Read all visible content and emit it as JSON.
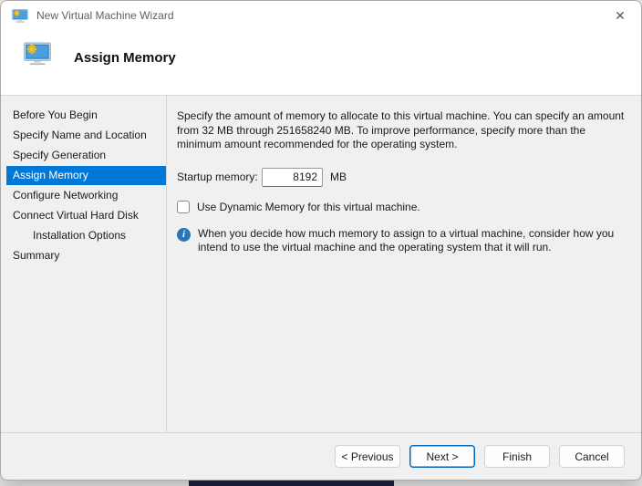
{
  "window": {
    "title": "New Virtual Machine Wizard",
    "icon": "vm-monitor-gear-icon",
    "close_glyph": "✕"
  },
  "header": {
    "title": "Assign Memory",
    "icon": "vm-monitor-gear-icon"
  },
  "sidebar": {
    "items": [
      {
        "label": "Before You Begin",
        "selected": false,
        "indent": false
      },
      {
        "label": "Specify Name and Location",
        "selected": false,
        "indent": false
      },
      {
        "label": "Specify Generation",
        "selected": false,
        "indent": false
      },
      {
        "label": "Assign Memory",
        "selected": true,
        "indent": false
      },
      {
        "label": "Configure Networking",
        "selected": false,
        "indent": false
      },
      {
        "label": "Connect Virtual Hard Disk",
        "selected": false,
        "indent": false
      },
      {
        "label": "Installation Options",
        "selected": false,
        "indent": true
      },
      {
        "label": "Summary",
        "selected": false,
        "indent": false
      }
    ]
  },
  "content": {
    "description": "Specify the amount of memory to allocate to this virtual machine. You can specify an amount from 32 MB through 251658240 MB. To improve performance, specify more than the minimum amount recommended for the operating system.",
    "startup_memory": {
      "label": "Startup memory:",
      "value": "8192",
      "unit": "MB"
    },
    "dynamic_memory": {
      "label": "Use Dynamic Memory for this virtual machine.",
      "checked": false
    },
    "info_note": {
      "icon": "info-icon",
      "glyph": "i",
      "text": "When you decide how much memory to assign to a virtual machine, consider how you intend to use the virtual machine and the operating system that it will run."
    }
  },
  "footer": {
    "buttons": [
      {
        "label": "< Previous",
        "primary": false
      },
      {
        "label": "Next >",
        "primary": true
      },
      {
        "label": "Finish",
        "primary": false
      },
      {
        "label": "Cancel",
        "primary": false
      }
    ]
  },
  "colors": {
    "accent_selection": "#0078d7",
    "primary_button_border": "#0067c0",
    "info_icon": "#2e74b5",
    "header_background": "#ffffff",
    "body_background": "#f0f0f0"
  }
}
